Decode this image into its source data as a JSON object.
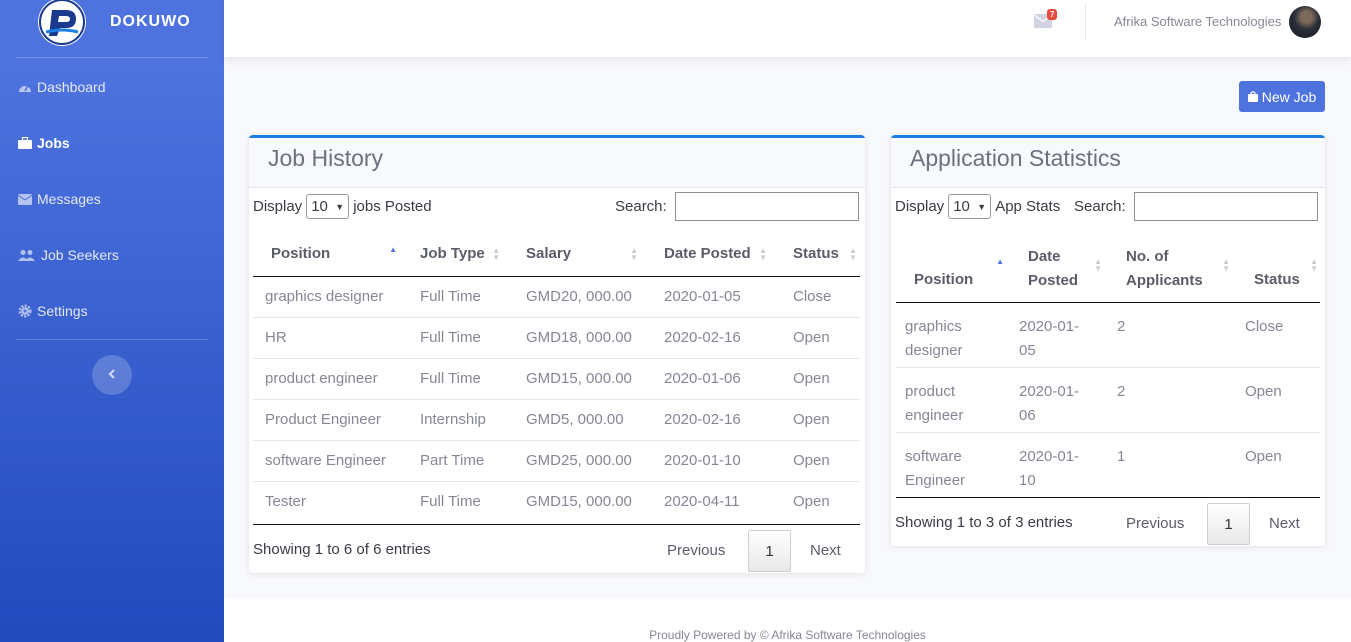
{
  "brand": {
    "name": "DOKUWO"
  },
  "sidebar": {
    "items": [
      {
        "label": "Dashboard",
        "icon": "tachometer-icon"
      },
      {
        "label": "Jobs",
        "icon": "briefcase-icon",
        "active": true
      },
      {
        "label": "Messages",
        "icon": "envelope-icon"
      },
      {
        "label": "Job Seekers",
        "icon": "users-icon"
      },
      {
        "label": "Settings",
        "icon": "gear-icon"
      }
    ]
  },
  "topbar": {
    "message_count": "7",
    "user_name": "Afrika Software Technologies"
  },
  "actions": {
    "new_job": "New Job"
  },
  "job_history": {
    "title": "Job History",
    "display_label": "Display",
    "display_value": "10",
    "display_suffix": "jobs Posted",
    "search_label": "Search:",
    "columns": [
      "Position",
      "Job Type",
      "Salary",
      "Date Posted",
      "Status"
    ],
    "rows": [
      [
        "graphics designer",
        "Full Time",
        "GMD20, 000.00",
        "2020-01-05",
        "Close"
      ],
      [
        "HR",
        "Full Time",
        "GMD18, 000.00",
        "2020-02-16",
        "Open"
      ],
      [
        "product engineer",
        "Full Time",
        "GMD15, 000.00",
        "2020-01-06",
        "Open"
      ],
      [
        "Product Engineer",
        "Internship",
        "GMD5, 000.00",
        "2020-02-16",
        "Open"
      ],
      [
        "software Engineer",
        "Part Time",
        "GMD25, 000.00",
        "2020-01-10",
        "Open"
      ],
      [
        "Tester",
        "Full Time",
        "GMD15, 000.00",
        "2020-04-11",
        "Open"
      ]
    ],
    "info": "Showing 1 to 6 of 6 entries",
    "previous": "Previous",
    "page": "1",
    "next": "Next"
  },
  "app_stats": {
    "title": "Application Statistics",
    "display_label": "Display",
    "display_value": "10",
    "display_suffix": "App Stats",
    "search_label": "Search:",
    "columns": [
      "Position",
      "Date Posted",
      "No. of Applicants",
      "Status"
    ],
    "rows": [
      [
        "graphics designer",
        "2020-01-05",
        "2",
        "Close"
      ],
      [
        "product engineer",
        "2020-01-06",
        "2",
        "Open"
      ],
      [
        "software Engineer",
        "2020-01-10",
        "1",
        "Open"
      ]
    ],
    "info": "Showing 1 to 3 of 3 entries",
    "previous": "Previous",
    "page": "1",
    "next": "Next"
  },
  "footer": {
    "text": "Proudly Powered by © Afrika Software Technologies"
  }
}
